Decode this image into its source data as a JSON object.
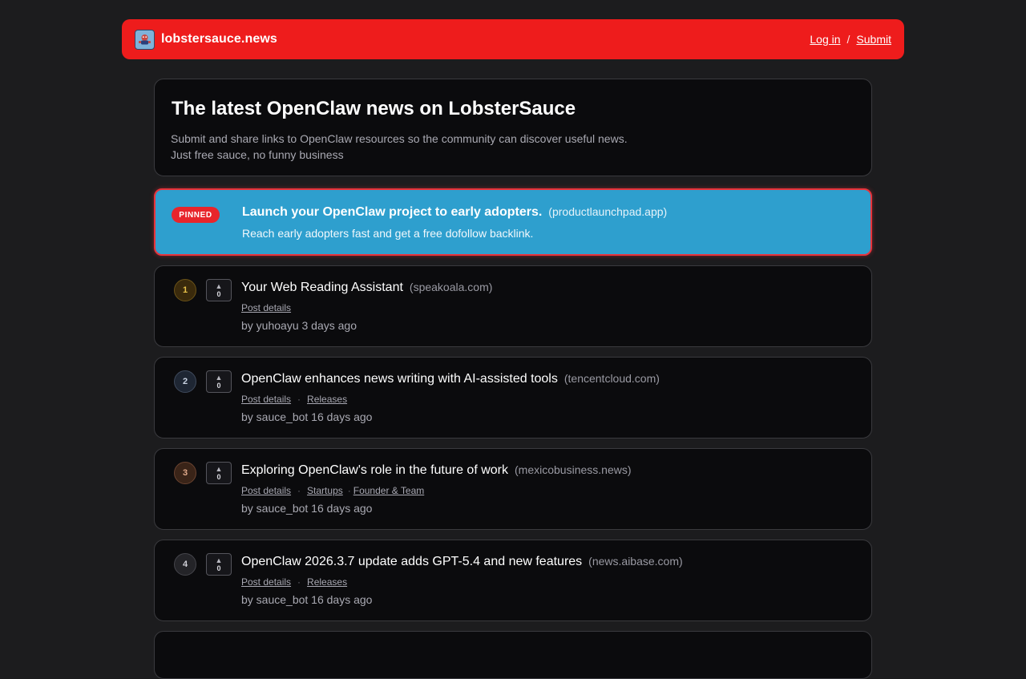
{
  "header": {
    "site_name": "lobstersauce.news",
    "login_label": "Log in",
    "separator": "/",
    "submit_label": "Submit",
    "brand_color": "#ee1c1c"
  },
  "hero": {
    "title": "The latest OpenClaw news on LobsterSauce",
    "line1": "Submit and share links to OpenClaw resources so the community can discover useful news.",
    "line2": "Just free sauce, no funny business"
  },
  "pinned": {
    "badge": "PINNED",
    "title": "Launch your OpenClaw project to early adopters.",
    "domain": "(productlaunchpad.app)",
    "description": "Reach early adopters fast and get a free dofollow backlink.",
    "background_color": "#2e9fce",
    "border_color": "#e8333b"
  },
  "stories": [
    {
      "rank": "1",
      "votes": "0",
      "title": "Your Web Reading Assistant",
      "domain": "(speakoala.com)",
      "links": [
        "Post details"
      ],
      "meta": "by yuhoayu 3 days ago",
      "rank_bg": "#3a2a0c",
      "rank_border": "#6b5318",
      "rank_color": "#e8c24a"
    },
    {
      "rank": "2",
      "votes": "0",
      "title": "OpenClaw enhances news writing with AI-assisted tools",
      "domain": "(tencentcloud.com)",
      "links": [
        "Post details",
        "Releases"
      ],
      "meta": "by sauce_bot 16 days ago",
      "rank_bg": "#1e2633",
      "rank_border": "#3f4a5c",
      "rank_color": "#c9d3e2"
    },
    {
      "rank": "3",
      "votes": "0",
      "title": "Exploring OpenClaw's role in the future of work",
      "domain": "(mexicobusiness.news)",
      "links": [
        "Post details",
        "Startups",
        "Founder & Team"
      ],
      "meta": "by sauce_bot 16 days ago",
      "rank_bg": "#3a2418",
      "rank_border": "#6a4330",
      "rank_color": "#e0a98a"
    },
    {
      "rank": "4",
      "votes": "0",
      "title": "OpenClaw 2026.3.7 update adds GPT-5.4 and new features",
      "domain": "(news.aibase.com)",
      "links": [
        "Post details",
        "Releases"
      ],
      "meta": "by sauce_bot 16 days ago",
      "rank_bg": "#242428",
      "rank_border": "#45454b",
      "rank_color": "#cfcfd6"
    }
  ]
}
